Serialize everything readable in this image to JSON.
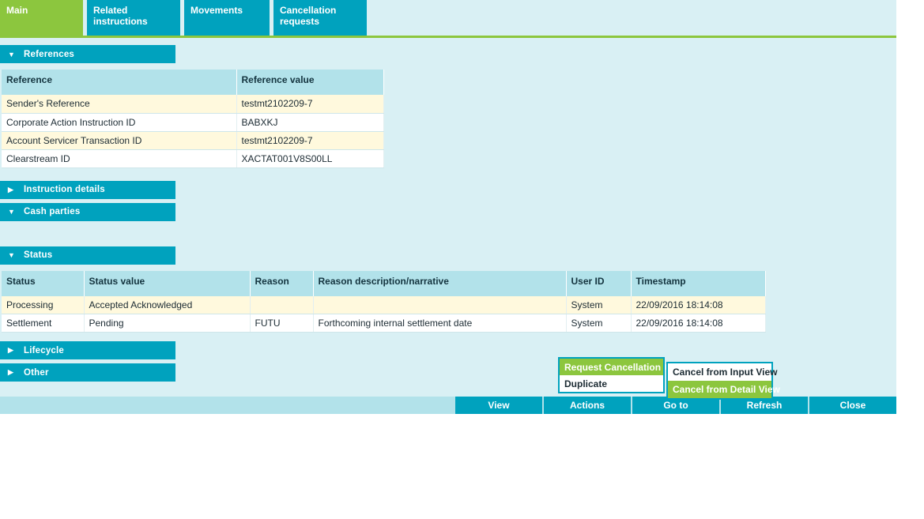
{
  "tabs": [
    {
      "label": "Main",
      "active": true
    },
    {
      "label": "Related instructions",
      "active": false
    },
    {
      "label": "Movements",
      "active": false
    },
    {
      "label": "Cancellation requests",
      "active": false
    }
  ],
  "sections": {
    "references": {
      "title": "References",
      "expanded": true,
      "caret": "▼"
    },
    "instruction_details": {
      "title": "Instruction details",
      "expanded": false,
      "caret": "▶"
    },
    "cash_parties": {
      "title": "Cash parties",
      "expanded": true,
      "caret": "▼"
    },
    "status": {
      "title": "Status",
      "expanded": true,
      "caret": "▼"
    },
    "lifecycle": {
      "title": "Lifecycle",
      "expanded": false,
      "caret": "▶"
    },
    "other": {
      "title": "Other",
      "expanded": false,
      "caret": "▶"
    }
  },
  "references_table": {
    "columns": [
      "Reference",
      "Reference value"
    ],
    "rows": [
      [
        "Sender's Reference",
        "testmt2102209-7"
      ],
      [
        "Corporate Action Instruction ID",
        "BABXKJ"
      ],
      [
        "Account Servicer Transaction ID",
        "testmt2102209-7"
      ],
      [
        "Clearstream ID",
        "XACTAT001V8S00LL"
      ]
    ]
  },
  "status_table": {
    "columns": [
      "Status",
      "Status value",
      "Reason",
      "Reason description/narrative",
      "User ID",
      "Timestamp"
    ],
    "rows": [
      [
        "Processing",
        "Accepted Acknowledged",
        "",
        "",
        "System",
        "22/09/2016 18:14:08"
      ],
      [
        "Settlement",
        "Pending",
        "FUTU",
        "Forthcoming internal settlement date",
        "System",
        "22/09/2016 18:14:08"
      ]
    ]
  },
  "context_menu": {
    "items": [
      {
        "label": "Request Cancellation",
        "highlighted": true,
        "has_submenu": true,
        "arrow": "▶"
      },
      {
        "label": "Duplicate",
        "highlighted": false,
        "has_submenu": false,
        "arrow": ""
      }
    ]
  },
  "context_submenu": {
    "items": [
      {
        "label": "Cancel from Input View",
        "highlighted": false
      },
      {
        "label": "Cancel from Detail View",
        "highlighted": true
      }
    ]
  },
  "toolbar": {
    "buttons": [
      "View",
      "Actions",
      "Go to",
      "Refresh",
      "Close"
    ]
  },
  "colors": {
    "teal": "#00a2be",
    "green": "#8cc63e",
    "page_bg": "#d9f0f4",
    "table_header": "#b2e2ea",
    "row_alt": "#fff9dd"
  }
}
